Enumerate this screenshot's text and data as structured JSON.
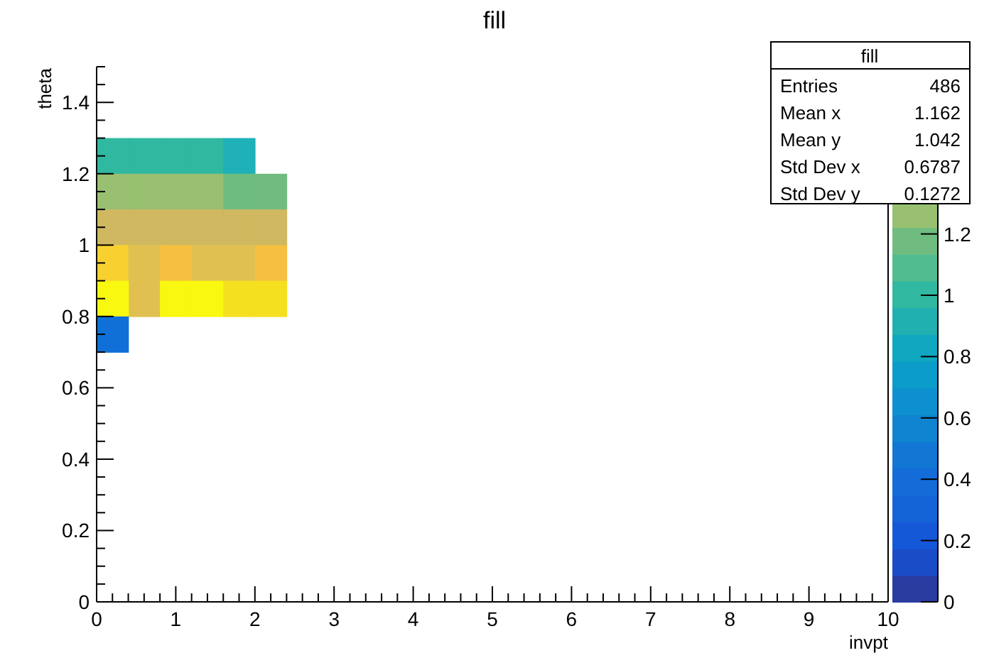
{
  "plot": {
    "chart_data": {
      "type": "scatter",
      "title": "fill",
      "xlabel": "invpt",
      "ylabel": "theta",
      "xlim": [
        0,
        10
      ],
      "ylim": [
        0,
        1.5
      ],
      "xticks": [
        0,
        1,
        2,
        3,
        4,
        5,
        6,
        7,
        8,
        9,
        10
      ],
      "yticks": [
        1.4,
        1.2,
        1,
        0.8,
        0.6,
        0.4,
        0.2,
        0
      ],
      "x": [
        0.2,
        0.6,
        1.0,
        1.4,
        1.8,
        2.2
      ],
      "series": [
        {
          "color": "#30b8a0",
          "values": [
            1.25,
            1.25,
            1.25,
            1.25,
            null,
            null
          ]
        },
        {
          "color": "#20b0b8",
          "values": [
            null,
            null,
            null,
            null,
            1.25,
            null
          ]
        },
        {
          "color": "#98c070",
          "values": [
            1.15,
            1.15,
            1.15,
            1.15,
            null,
            null
          ]
        },
        {
          "color": "#70bc80",
          "values": [
            null,
            null,
            null,
            null,
            1.15,
            1.15
          ]
        },
        {
          "color": "#d0b860",
          "values": [
            1.05,
            1.05,
            1.05,
            1.05,
            1.05,
            1.05
          ]
        },
        {
          "color": "#f8d030",
          "values": [
            0.95,
            null,
            null,
            null,
            null,
            null
          ]
        },
        {
          "color": "#e0c050",
          "values": [
            null,
            0.95,
            null,
            0.95,
            0.95,
            null
          ]
        },
        {
          "color": "#f5c040",
          "values": [
            null,
            null,
            0.95,
            null,
            null,
            0.95
          ]
        },
        {
          "color": "#e0c050",
          "values": [
            null,
            0.85,
            null,
            null,
            null,
            null
          ]
        },
        {
          "color": "#f8f810",
          "values": [
            0.85,
            null,
            0.85,
            0.85,
            null,
            null
          ]
        },
        {
          "color": "#f5e020",
          "values": [
            null,
            null,
            null,
            null,
            0.85,
            0.85
          ]
        },
        {
          "color": "#1070d8",
          "values": [
            0.75,
            null,
            null,
            null,
            null,
            null
          ]
        }
      ]
    }
  },
  "colorbar": {
    "ticks": [
      "1.2",
      "1",
      "0.8",
      "0.6",
      "0.4",
      "0.2",
      "0"
    ]
  },
  "stats": {
    "title": "fill",
    "rows": [
      {
        "label": "Entries",
        "value": "486"
      },
      {
        "label": "Mean x",
        "value": "1.162"
      },
      {
        "label": "Mean y",
        "value": "1.042"
      },
      {
        "label": "Std Dev x",
        "value": "0.6787"
      },
      {
        "label": "Std Dev y",
        "value": "0.1272"
      }
    ]
  }
}
